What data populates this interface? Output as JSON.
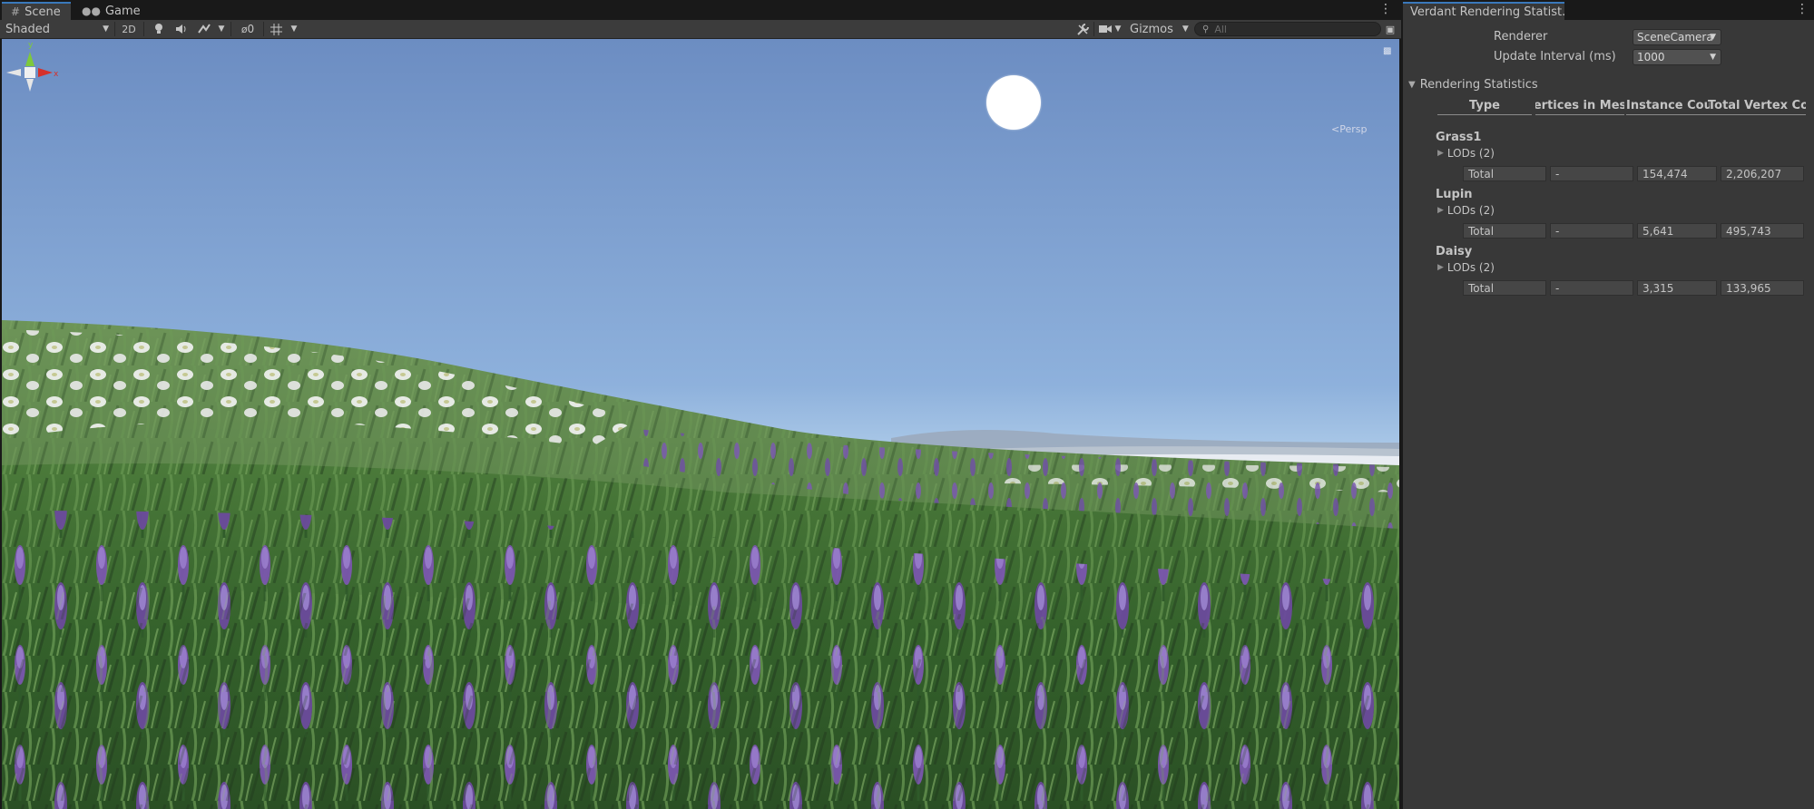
{
  "scene_window": {
    "tabs": [
      {
        "label": "Scene",
        "icon": "grid-icon"
      },
      {
        "label": "Game",
        "icon": "gamepad-icon"
      }
    ],
    "toolbar": {
      "draw_mode": "Shaded",
      "mode_2d": "2D",
      "hidden_count": "0",
      "gizmos_label": "Gizmos",
      "search_placeholder": "All"
    },
    "gizmo": {
      "axis_y": "y",
      "axis_x": "x",
      "projection": "Persp"
    }
  },
  "inspector": {
    "title": "Verdant Rendering Statist...",
    "renderer_label": "Renderer",
    "renderer_value": "SceneCamera",
    "interval_label": "Update Interval (ms)",
    "interval_value": "1000",
    "stats_foldout_label": "Rendering Statistics",
    "columns": [
      "Type",
      "Vertices in Mesh",
      "Instance Count",
      "Total Vertex Count"
    ],
    "groups": [
      {
        "name": "Grass1",
        "lods_label": "LODs (2)",
        "total": {
          "label": "Total",
          "vertices": "-",
          "instances": "154,474",
          "total_vertices": "2,206,207"
        }
      },
      {
        "name": "Lupin",
        "lods_label": "LODs (2)",
        "total": {
          "label": "Total",
          "vertices": "-",
          "instances": "5,641",
          "total_vertices": "495,743"
        }
      },
      {
        "name": "Daisy",
        "lods_label": "LODs (2)",
        "total": {
          "label": "Total",
          "vertices": "-",
          "instances": "3,315",
          "total_vertices": "133,965"
        }
      }
    ]
  },
  "colors": {
    "accent_tab": "#3a79bb",
    "sky_top": "#6d8ec3",
    "sky_horizon": "#dfeefb",
    "grass": "#4f7a3e",
    "lupin": "#7d58b0",
    "daisy": "#f2f2f2",
    "gizmo_y": "#7ec93c",
    "gizmo_x": "#d6302a"
  }
}
